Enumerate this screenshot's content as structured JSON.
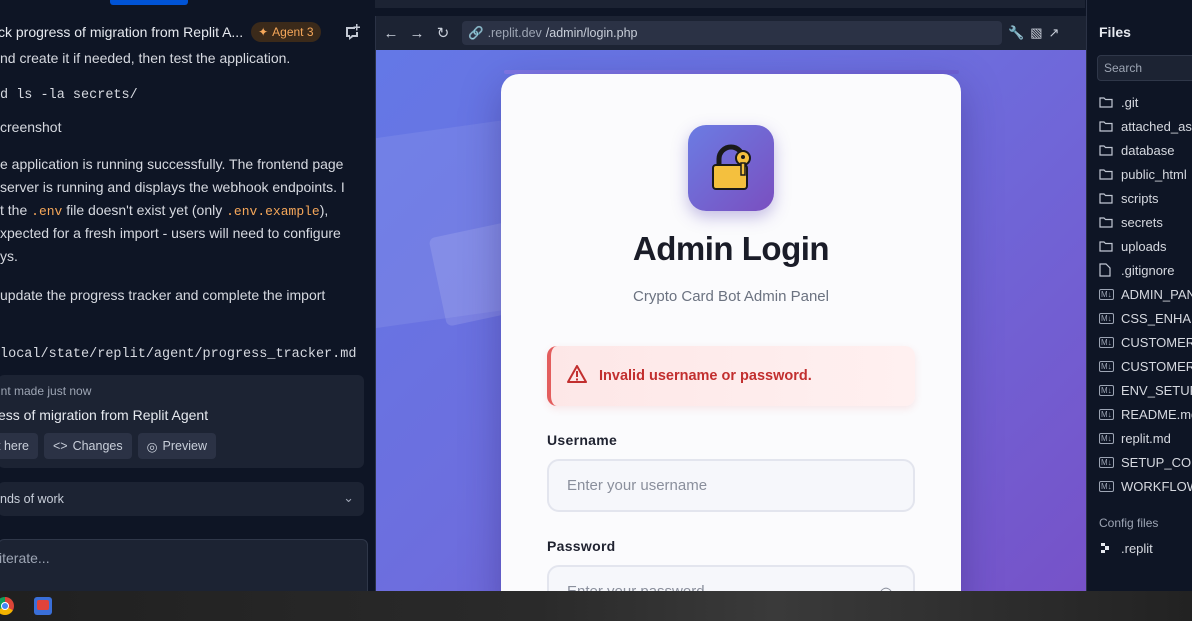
{
  "agent": {
    "title": "ck progress of migration from Replit A...",
    "badge": "Agent 3",
    "messages": [
      "nd create it if needed, then test the application.",
      "d ls -la secrets/",
      "creenshot",
      "e application is running successfully. The frontend page",
      "server is running and displays the webhook endpoints. I",
      "t the",
      ".env",
      "file doesn't exist yet (only",
      ".env.example",
      "),",
      "xpected for a fresh import - users will need to configure",
      "ys.",
      " update the progress tracker and complete the import",
      "local/state/replit/agent/progress_tracker.md"
    ],
    "checkpoint": {
      "small": "int made just now",
      "title": "ess of migration from Replit Agent",
      "btn_here": "t here",
      "btn_changes": "Changes",
      "btn_preview": "Preview"
    },
    "work_label": "nds of work",
    "prompt_placeholder": "iterate..."
  },
  "browser": {
    "url_host": ".replit.dev",
    "url_path": "/admin/login.php"
  },
  "login": {
    "title": "Admin Login",
    "subtitle": "Crypto Card Bot Admin Panel",
    "alert": "Invalid username or password.",
    "username_label": "Username",
    "username_placeholder": "Enter your username",
    "password_label": "Password",
    "password_placeholder": "Enter your password"
  },
  "files": {
    "title": "Files",
    "search_placeholder": "Search",
    "items": [
      {
        "name": ".git",
        "type": "folder"
      },
      {
        "name": "attached_as",
        "type": "folder"
      },
      {
        "name": "database",
        "type": "folder"
      },
      {
        "name": "public_html",
        "type": "folder"
      },
      {
        "name": "scripts",
        "type": "folder"
      },
      {
        "name": "secrets",
        "type": "folder"
      },
      {
        "name": "uploads",
        "type": "folder"
      },
      {
        "name": ".gitignore",
        "type": "file"
      },
      {
        "name": "ADMIN_PAN",
        "type": "md"
      },
      {
        "name": "CSS_ENHAN",
        "type": "md"
      },
      {
        "name": "CUSTOMER_",
        "type": "md"
      },
      {
        "name": "CUSTOMER_",
        "type": "md"
      },
      {
        "name": "ENV_SETUP_",
        "type": "md"
      },
      {
        "name": "README.md",
        "type": "md"
      },
      {
        "name": "replit.md",
        "type": "md"
      },
      {
        "name": "SETUP_COM",
        "type": "md"
      },
      {
        "name": "WORKFLOW",
        "type": "md"
      }
    ],
    "config_title": "Config files",
    "config_item": ".replit"
  }
}
